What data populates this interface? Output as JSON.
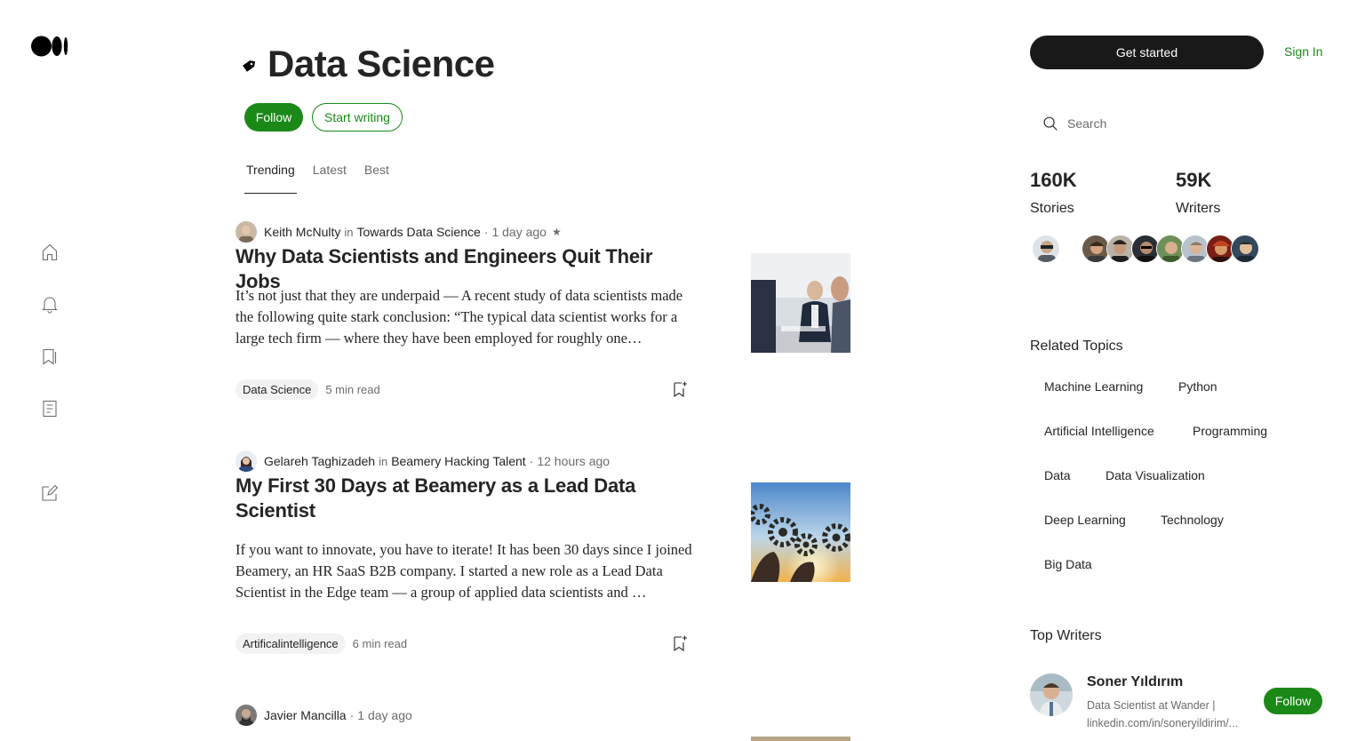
{
  "brand": {
    "logo_icon": "medium-logo-icon"
  },
  "rail": [
    {
      "name": "home-icon"
    },
    {
      "name": "bell-icon"
    },
    {
      "name": "bookmarks-icon"
    },
    {
      "name": "stories-icon"
    },
    {
      "name": "write-icon"
    }
  ],
  "header": {
    "title": "Data Science",
    "follow_label": "Follow",
    "write_label": "Start writing"
  },
  "tabs": [
    "Trending",
    "Latest",
    "Best"
  ],
  "active_tab": "Trending",
  "articles": [
    {
      "author": "Keith McNulty",
      "in": "in",
      "publication": "Towards Data Science",
      "time": "1 day ago",
      "star": "★",
      "title": "Why Data Scientists and Engineers Quit Their Jobs",
      "excerpt": "It’s not just that they are underpaid — A recent study of data scientists made the following quite stark conclusion: “The typical data scientist works for a large tech firm — where they have been employed for roughly one…",
      "tag": "Data Science",
      "read_time": "5 min read"
    },
    {
      "author": "Gelareh Taghizadeh",
      "in": "in",
      "publication": "Beamery Hacking Talent",
      "time": "12 hours ago",
      "title": "My First 30 Days at Beamery as a Lead Data Scientist",
      "excerpt": "If you want to innovate, you have to iterate! It has been 30 days since I joined Beamery, an HR SaaS B2B company. I started a new role as a Lead Data Scientist in the Edge team — a group of applied data scientists and …",
      "tag": "Artificalintelligence",
      "read_time": "6 min read"
    },
    {
      "author": "Javier Mancilla",
      "time": "1 day ago"
    }
  ],
  "sidebar": {
    "get_started": "Get started",
    "sign_in": "Sign In",
    "search_placeholder": "Search",
    "stats": [
      {
        "value": "160K",
        "label": "Stories"
      },
      {
        "value": "59K",
        "label": "Writers"
      }
    ],
    "related_title": "Related Topics",
    "related_topics": [
      "Machine Learning",
      "Python",
      "Artificial Intelligence",
      "Programming",
      "Data",
      "Data Visualization",
      "Deep Learning",
      "Technology",
      "Big Data"
    ],
    "top_writers_title": "Top Writers",
    "top_writer": {
      "name": "Soner Yıldırım",
      "bio": "Data Scientist at Wander | linkedin.com/in/soneryildirim/...",
      "follow_label": "Follow"
    }
  },
  "colors": {
    "accent": "#1a8917",
    "dark": "#191919",
    "muted": "#6b6b6b"
  }
}
